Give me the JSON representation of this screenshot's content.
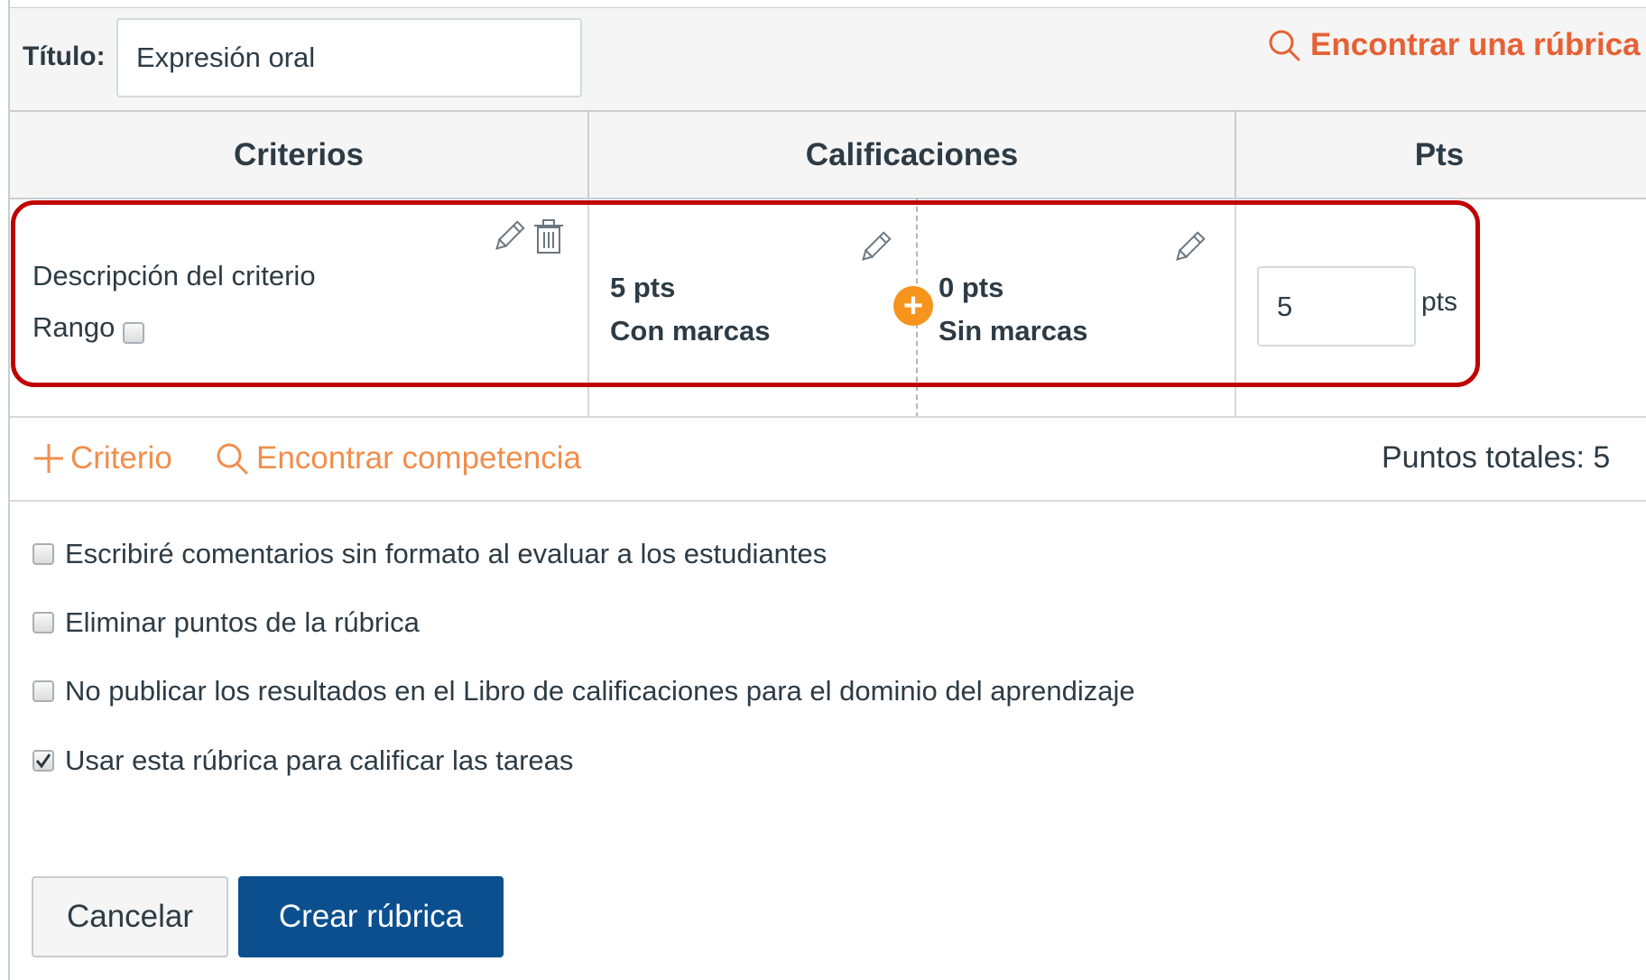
{
  "title_field": {
    "label": "Título:",
    "value": "Expresión oral"
  },
  "find_rubric_label": "Encontrar una rúbrica",
  "columns": {
    "criteria": "Criterios",
    "ratings": "Calificaciones",
    "points": "Pts"
  },
  "criterion": {
    "description": "Descripción del criterio",
    "range_label": "Rango",
    "range_checked": false,
    "ratings": [
      {
        "points": "5 pts",
        "description": "Con marcas"
      },
      {
        "points": "0 pts",
        "description": "Sin marcas"
      }
    ],
    "points_value": "5",
    "points_unit": "pts"
  },
  "actions": {
    "add_criterion": "Criterio",
    "find_outcome": "Encontrar competencia",
    "total_points": "Puntos totales: 5"
  },
  "options": [
    {
      "label": "Escribiré comentarios sin formato al evaluar a los estudiantes",
      "checked": false
    },
    {
      "label": "Eliminar puntos de la rúbrica",
      "checked": false
    },
    {
      "label": "No publicar los resultados en el Libro de calificaciones para el dominio del aprendizaje",
      "checked": false
    },
    {
      "label": "Usar esta rúbrica para calificar las tareas",
      "checked": true
    }
  ],
  "buttons": {
    "cancel": "Cancelar",
    "create": "Crear rúbrica"
  },
  "colors": {
    "accent": "#e66135",
    "link": "#f08e4d",
    "primary": "#0b4f8f",
    "highlight": "#c00000",
    "add_rating": "#f7941d"
  }
}
